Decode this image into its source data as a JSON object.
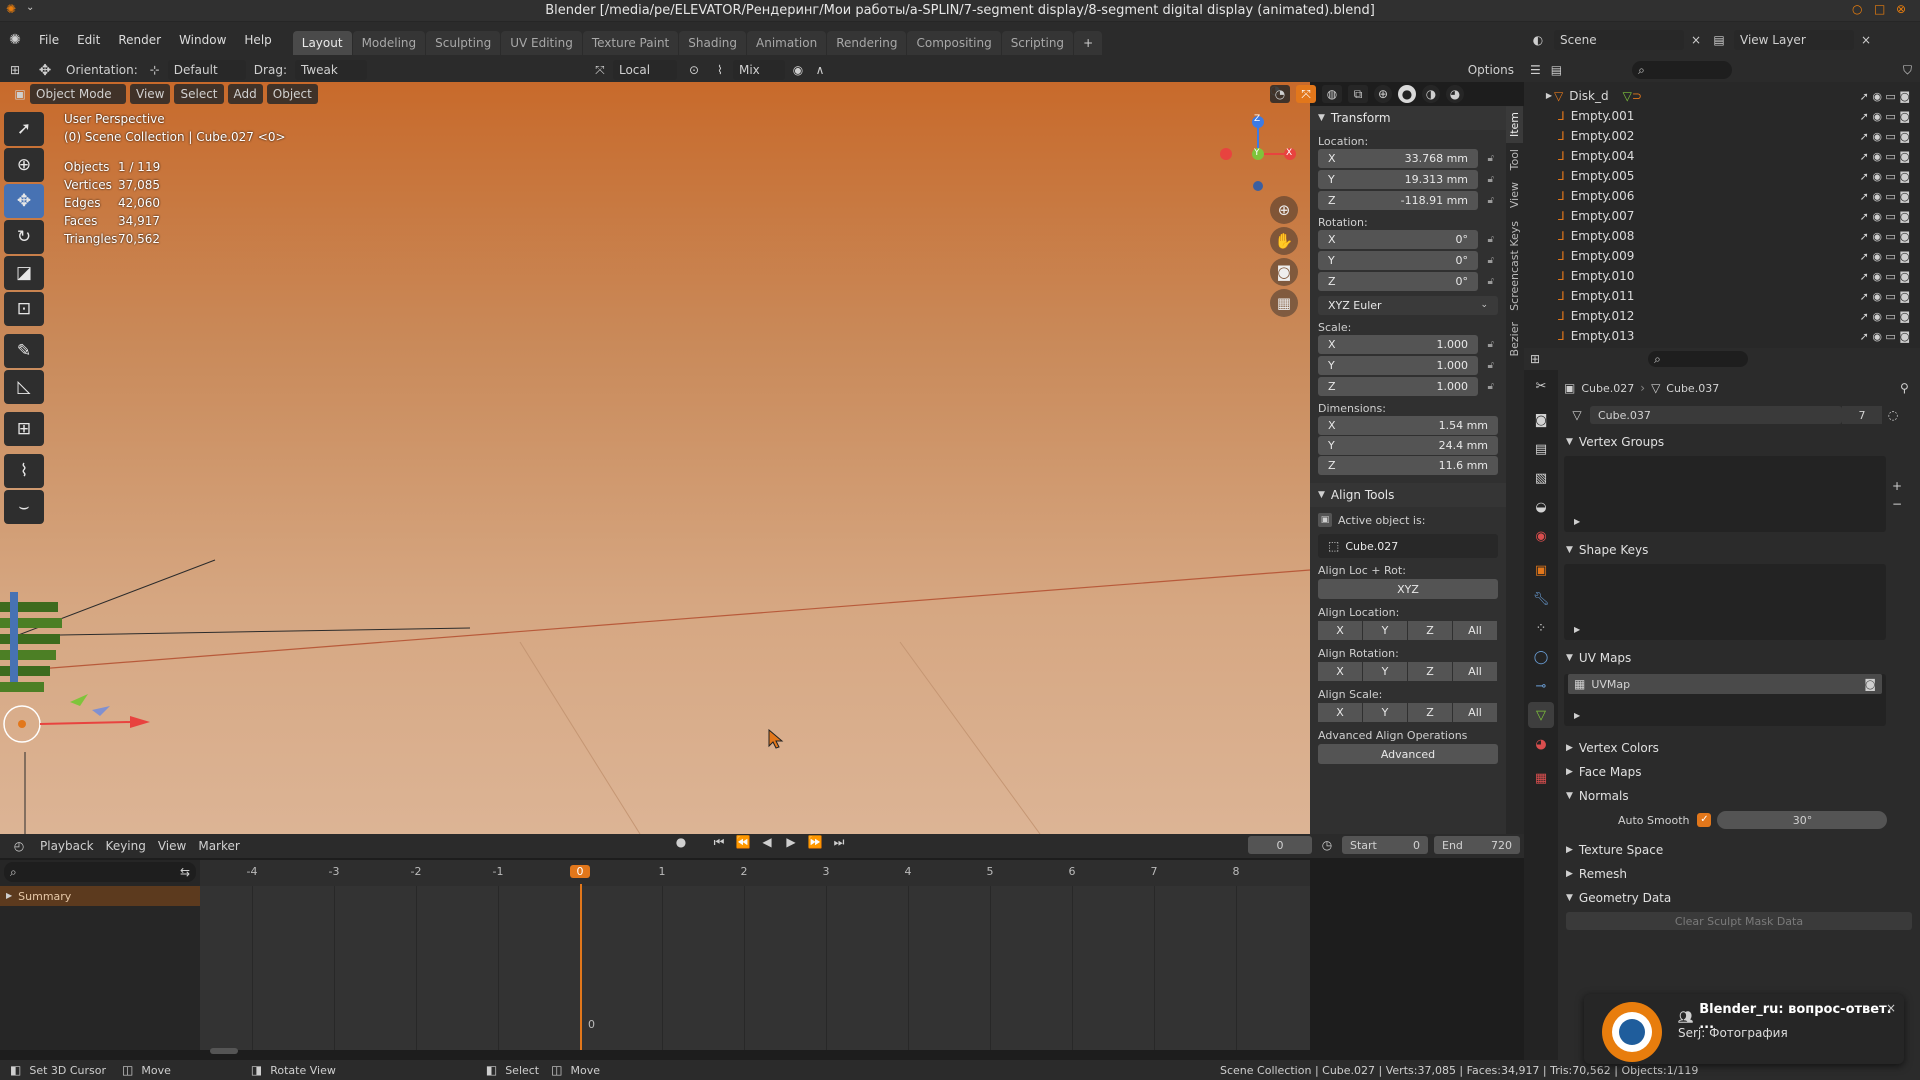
{
  "titlebar": {
    "title": "Blender [/media/pe/ELEVATOR/Рендеринг/Мои работы/a-SPLIN/7-segment display/8-segment digital display (animated).blend]"
  },
  "menubar": {
    "menus": [
      "File",
      "Edit",
      "Render",
      "Window",
      "Help"
    ],
    "workspaces": [
      "Layout",
      "Modeling",
      "Sculpting",
      "UV Editing",
      "Texture Paint",
      "Shading",
      "Animation",
      "Rendering",
      "Compositing",
      "Scripting"
    ],
    "active_workspace": "Layout",
    "scene": "Scene",
    "view_layer": "View Layer"
  },
  "header": {
    "orientation_label": "Orientation:",
    "orientation_value": "Default",
    "drag_label": "Drag:",
    "drag_value": "Tweak",
    "transform_space": "Local",
    "snap_mode": "Mix",
    "options": "Options"
  },
  "viewport_header": {
    "mode": "Object Mode",
    "menus": [
      "View",
      "Select",
      "Add",
      "Object"
    ]
  },
  "viewport": {
    "perspective": "User Perspective",
    "collection": "(0) Scene Collection | Cube.027 <0>",
    "stats": [
      {
        "label": "Objects",
        "value": "1 / 119"
      },
      {
        "label": "Vertices",
        "value": "37,085"
      },
      {
        "label": "Edges",
        "value": "42,060"
      },
      {
        "label": "Faces",
        "value": "34,917"
      },
      {
        "label": "Triangles",
        "value": "70,562"
      }
    ],
    "gizmo": {
      "x": "X",
      "y": "Y",
      "z": "Z"
    }
  },
  "npanel": {
    "tabs": [
      "Item",
      "Tool",
      "View",
      "Screencast Keys",
      "Bezier"
    ],
    "transform": {
      "title": "Transform",
      "location_label": "Location:",
      "location": [
        {
          "axis": "X",
          "value": "33.768 mm"
        },
        {
          "axis": "Y",
          "value": "19.313 mm"
        },
        {
          "axis": "Z",
          "value": "-118.91 mm"
        }
      ],
      "rotation_label": "Rotation:",
      "rotation": [
        {
          "axis": "X",
          "value": "0°"
        },
        {
          "axis": "Y",
          "value": "0°"
        },
        {
          "axis": "Z",
          "value": "0°"
        }
      ],
      "rotation_mode": "XYZ Euler",
      "scale_label": "Scale:",
      "scale": [
        {
          "axis": "X",
          "value": "1.000"
        },
        {
          "axis": "Y",
          "value": "1.000"
        },
        {
          "axis": "Z",
          "value": "1.000"
        }
      ],
      "dimensions_label": "Dimensions:",
      "dimensions": [
        {
          "axis": "X",
          "value": "1.54 mm"
        },
        {
          "axis": "Y",
          "value": "24.4 mm"
        },
        {
          "axis": "Z",
          "value": "11.6 mm"
        }
      ]
    },
    "align": {
      "title": "Align Tools",
      "active_label": "Active object is:",
      "active_object": "Cube.027",
      "loc_rot_label": "Align Loc + Rot:",
      "loc_rot_button": "XYZ",
      "location_label": "Align Location:",
      "rotation_label": "Align Rotation:",
      "scale_label": "Align Scale:",
      "axes": [
        "X",
        "Y",
        "Z",
        "All"
      ],
      "advanced_label": "Advanced Align Operations",
      "advanced_button": "Advanced"
    }
  },
  "outliner": {
    "items": [
      "Disk_d",
      "Empty.001",
      "Empty.002",
      "Empty.004",
      "Empty.005",
      "Empty.006",
      "Empty.007",
      "Empty.008",
      "Empty.009",
      "Empty.010",
      "Empty.011",
      "Empty.012",
      "Empty.013"
    ]
  },
  "properties": {
    "object_name": "Cube.027",
    "mesh_name": "Cube.037",
    "data_block": "Cube.037",
    "users": "7",
    "sections": {
      "vertex_groups": "Vertex Groups",
      "shape_keys": "Shape Keys",
      "uv_maps": "UV Maps",
      "uv_map_name": "UVMap",
      "vertex_colors": "Vertex Colors",
      "face_maps": "Face Maps",
      "normals": "Normals",
      "auto_smooth_label": "Auto Smooth",
      "auto_smooth_angle": "30°",
      "texture_space": "Texture Space",
      "remesh": "Remesh",
      "geometry_data": "Geometry Data",
      "clear_sculpt": "Clear Sculpt Mask Data"
    }
  },
  "timeline": {
    "menus": [
      "Playback",
      "Keying",
      "View",
      "Marker"
    ],
    "current_frame": "0",
    "start_label": "Start",
    "start": "0",
    "end_label": "End",
    "end": "720",
    "ruler": [
      "-4",
      "-3",
      "-2",
      "-1",
      "0",
      "1",
      "2",
      "3",
      "4",
      "5",
      "6",
      "7",
      "8"
    ],
    "summary": "Summary",
    "marker_frame": "0"
  },
  "status": {
    "left": [
      {
        "icon": "mouse-left-icon",
        "text": "Set 3D Cursor"
      },
      {
        "icon": "mouse-middle-icon",
        "text": "Move"
      },
      {
        "icon": "mouse-right-icon",
        "text": "Rotate View"
      },
      {
        "icon": "mouse-left-icon",
        "text": "Select"
      },
      {
        "icon": "mouse-middle-icon",
        "text": "Move"
      }
    ],
    "right": "Scene Collection | Cube.027 | Verts:37,085 | Faces:34,917 | Tris:70,562 | Objects:1/119"
  },
  "notification": {
    "title": "Blender_ru: вопрос-ответ. ...",
    "body": "Serj: Фотография"
  },
  "colors": {
    "accent": "#4772b3",
    "frame_marker": "#e2771b",
    "x_axis": "#e8433f",
    "y_axis": "#7ec43b",
    "z_axis": "#3c7be5"
  }
}
